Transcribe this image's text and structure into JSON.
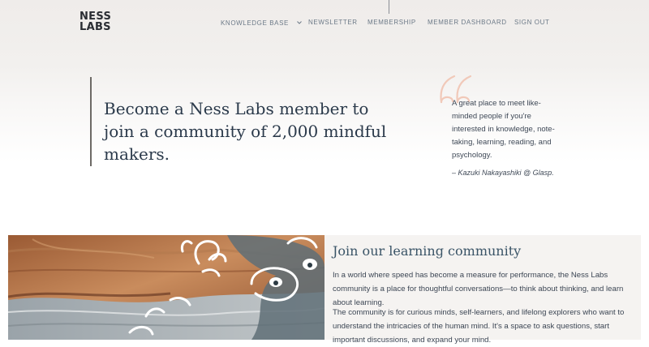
{
  "logo": {
    "line1": "NESS",
    "line2": "LABS"
  },
  "nav": {
    "items": [
      {
        "label": "KNOWLEDGE BASE",
        "has_dropdown": true
      },
      {
        "label": "NEWSLETTER"
      },
      {
        "label": "MEMBERSHIP"
      },
      {
        "label": "MEMBER DASHBOARD"
      },
      {
        "label": "SIGN OUT"
      }
    ],
    "dropdown_icon": "chevron-down-icon"
  },
  "hero": {
    "headline": "Become a Ness Labs member to join a community of 2,000 mindful makers."
  },
  "testimonial": {
    "icon": "quote-icon",
    "quote": "A great place to meet like-minded people if you're interested in knowledge, note-taking, learning, reading, and psychology.",
    "author": "– Kazuki Nakayashiki @ Glasp."
  },
  "community": {
    "title": "Join our learning community",
    "paragraph1": "In a world where speed has become a measure for performance, the Ness Labs community is a place for thoughtful conversations—to think about thinking, and learn about learning.",
    "paragraph2": "The community is for curious minds, self-learners, and lifelong explorers who want to understand the intricacies of the human mind. It's a space to ask questions, start important discussions, and expand your mind."
  },
  "colors": {
    "heading": "#2b3a4b",
    "nav_text": "#6c7a88",
    "quote_mark": "#f1c9b9",
    "section_bg": "#f5f3f1",
    "accent_title": "#3a5467"
  }
}
